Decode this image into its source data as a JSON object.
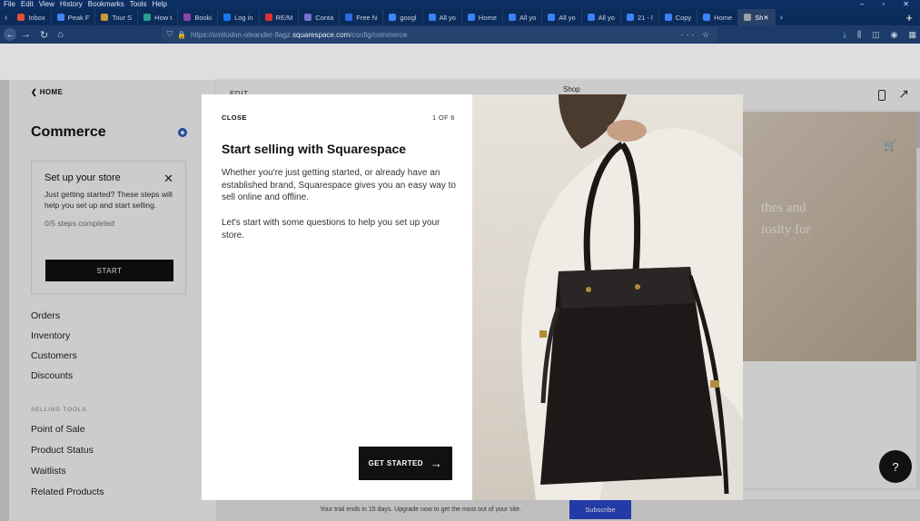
{
  "browser": {
    "menu": [
      "File",
      "Edit",
      "View",
      "History",
      "Bookmarks",
      "Tools",
      "Help"
    ],
    "tabs": [
      {
        "label": "Inbox",
        "color": "#e44c3c"
      },
      {
        "label": "Peak F",
        "color": "#4285f4"
      },
      {
        "label": "Tour S",
        "color": "#c99a3a"
      },
      {
        "label": "How t",
        "color": "#2a9d8f"
      },
      {
        "label": "Booki",
        "color": "#8e44ad"
      },
      {
        "label": "Log in",
        "color": "#1877f2"
      },
      {
        "label": "RE/M",
        "color": "#d33"
      },
      {
        "label": "Conta",
        "color": "#7a6fcf"
      },
      {
        "label": "Free N",
        "color": "#2d6cdf"
      },
      {
        "label": "googl",
        "color": "#4285f4"
      },
      {
        "label": "All yo",
        "color": "#3b82f6"
      },
      {
        "label": "Home",
        "color": "#3b82f6"
      },
      {
        "label": "All yo",
        "color": "#3b82f6"
      },
      {
        "label": "All yo",
        "color": "#3b82f6"
      },
      {
        "label": "All yo",
        "color": "#3b82f6"
      },
      {
        "label": "21 - l",
        "color": "#3b82f6"
      },
      {
        "label": "Copy",
        "color": "#3b82f6"
      },
      {
        "label": "Home",
        "color": "#3b82f6"
      },
      {
        "label": "Sh",
        "color": "#9aa0a6",
        "active": true
      }
    ],
    "url_prefix": "https://smilodon-oleander-8agz.",
    "url_host": "squarespace.com",
    "url_path": "/config/commerce",
    "url_actions": "··· ☆"
  },
  "sidebar": {
    "home_link": "HOME",
    "title": "Commerce",
    "setup_card": {
      "title": "Set up your store",
      "description": "Just getting started? These steps will help you set up and start selling.",
      "progress": "0/5 steps completed",
      "start_label": "START"
    },
    "items": [
      {
        "label": "Orders"
      },
      {
        "label": "Inventory"
      },
      {
        "label": "Customers"
      },
      {
        "label": "Discounts"
      }
    ],
    "selling_tools_heading": "SELLING TOOLS",
    "selling_tools": [
      {
        "label": "Point of Sale"
      },
      {
        "label": "Product Status"
      },
      {
        "label": "Waitlists"
      },
      {
        "label": "Related Products"
      }
    ]
  },
  "preview": {
    "edit_label": "EDIT",
    "page_label": "Shop",
    "hero_text": [
      "thes and",
      "iosity for"
    ]
  },
  "modal": {
    "close_label": "CLOSE",
    "step_label": "1 OF 6",
    "title": "Start selling with Squarespace",
    "body_1": "Whether you're just getting started, or already have an established brand, Squarespace gives you an easy way to sell online and offline.",
    "body_2": "Let's start with some questions to help you set up your store.",
    "cta_label": "GET STARTED"
  },
  "trial_bar": {
    "text": "Your trial ends in 15 days. Upgrade now to get the most out of your site.",
    "subscribe_label": "Subscribe"
  },
  "help_bubble": "?"
}
